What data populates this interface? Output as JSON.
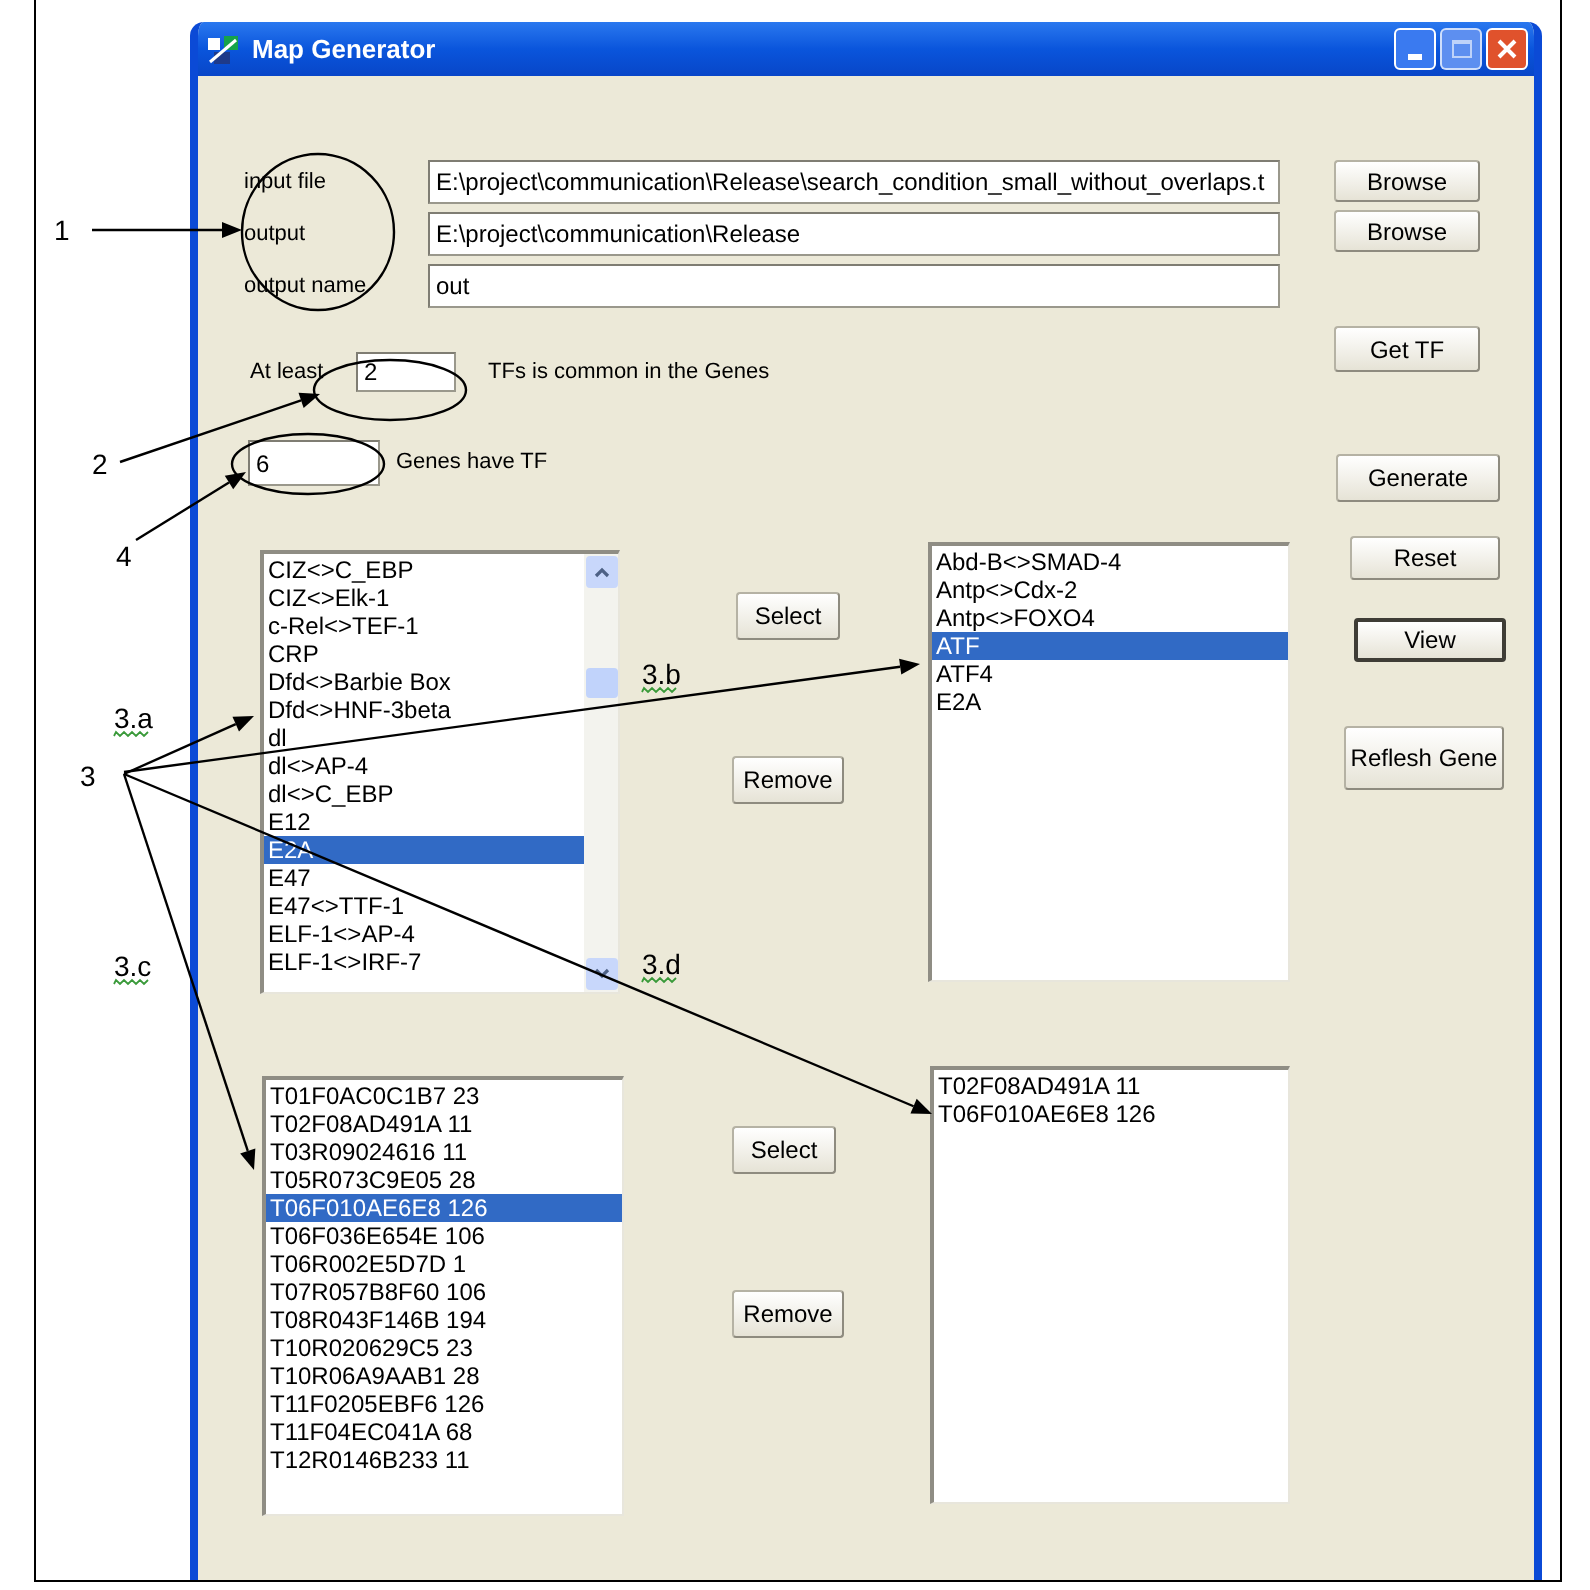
{
  "window": {
    "title": "Map Generator"
  },
  "file_rows": [
    {
      "label": "input file",
      "value": "E:\\project\\communication\\Release\\search_condition_small_without_overlaps.t",
      "button": "Browse"
    },
    {
      "label": "output",
      "value": "E:\\project\\communication\\Release",
      "button": "Browse"
    },
    {
      "label": "output name",
      "value": "out"
    }
  ],
  "get_tf_button": "Get TF",
  "at_least": {
    "prefix": "At least",
    "value": "2",
    "suffix": "TFs is common in the Genes"
  },
  "genes_have": {
    "value": "6",
    "suffix": "Genes have TF"
  },
  "side_buttons": [
    {
      "label": "Generate",
      "focused": false
    },
    {
      "label": "Reset",
      "focused": false
    },
    {
      "label": "View",
      "focused": true
    },
    {
      "label": "Reflesh Gene",
      "focused": false
    }
  ],
  "pairs": [
    {
      "source": {
        "items": [
          {
            "text": "CIZ<>C_EBP",
            "selected": false
          },
          {
            "text": "CIZ<>Elk-1",
            "selected": false
          },
          {
            "text": "c-Rel<>TEF-1",
            "selected": false
          },
          {
            "text": "CRP",
            "selected": false
          },
          {
            "text": "Dfd<>Barbie Box",
            "selected": false
          },
          {
            "text": "Dfd<>HNF-3beta",
            "selected": false
          },
          {
            "text": "dl",
            "selected": false
          },
          {
            "text": "dl<>AP-4",
            "selected": false
          },
          {
            "text": "dl<>C_EBP",
            "selected": false
          },
          {
            "text": "E12",
            "selected": false
          },
          {
            "text": "E2A",
            "selected": true
          },
          {
            "text": "E47",
            "selected": false
          },
          {
            "text": "E47<>TTF-1",
            "selected": false
          },
          {
            "text": "ELF-1<>AP-4",
            "selected": false
          },
          {
            "text": "ELF-1<>IRF-7",
            "selected": false
          }
        ],
        "scrollbar": true
      },
      "select_button": "Select",
      "remove_button": "Remove",
      "target": {
        "items": [
          {
            "text": "Abd-B<>SMAD-4",
            "selected": false
          },
          {
            "text": "Antp<>Cdx-2",
            "selected": false
          },
          {
            "text": "Antp<>FOXO4",
            "selected": false
          },
          {
            "text": "ATF",
            "selected": true
          },
          {
            "text": "ATF4",
            "selected": false
          },
          {
            "text": "E2A",
            "selected": false
          }
        ]
      }
    },
    {
      "source": {
        "items": [
          {
            "text": "T01F0AC0C1B7 23",
            "selected": false
          },
          {
            "text": "T02F08AD491A 11",
            "selected": false
          },
          {
            "text": "T03R09024616 11",
            "selected": false
          },
          {
            "text": "T05R073C9E05 28",
            "selected": false
          },
          {
            "text": "T06F010AE6E8 126",
            "selected": true
          },
          {
            "text": "T06F036E654E 106",
            "selected": false
          },
          {
            "text": "T06R002E5D7D 1",
            "selected": false
          },
          {
            "text": "T07R057B8F60 106",
            "selected": false
          },
          {
            "text": "T08R043F146B 194",
            "selected": false
          },
          {
            "text": "T10R020629C5 23",
            "selected": false
          },
          {
            "text": "T10R06A9AAB1 28",
            "selected": false
          },
          {
            "text": "T11F0205EBF6 126",
            "selected": false
          },
          {
            "text": "T11F04EC041A 68",
            "selected": false
          },
          {
            "text": "T12R0146B233 11",
            "selected": false
          }
        ]
      },
      "select_button": "Select",
      "remove_button": "Remove",
      "target": {
        "items": [
          {
            "text": "T02F08AD491A 11",
            "selected": false
          },
          {
            "text": "T06F010AE6E8 126",
            "selected": false
          }
        ]
      }
    }
  ],
  "annotations": [
    {
      "label": "1"
    },
    {
      "label": "2"
    },
    {
      "label": "4"
    },
    {
      "label": "3"
    },
    {
      "label": "3.a"
    },
    {
      "label": "3.b"
    },
    {
      "label": "3.c"
    },
    {
      "label": "3.d"
    }
  ]
}
